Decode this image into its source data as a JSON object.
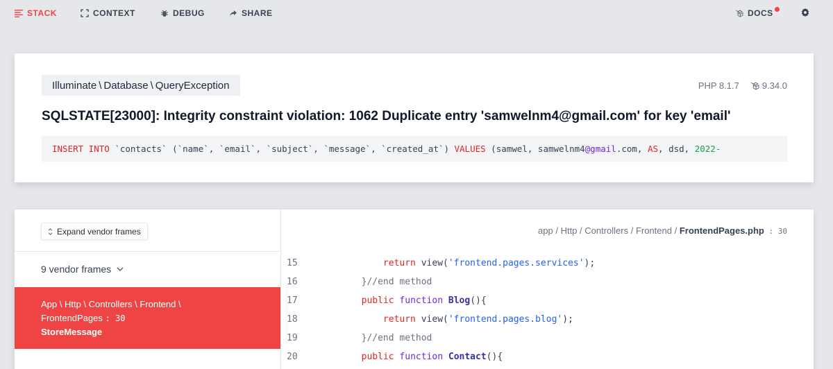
{
  "nav": {
    "stack": "STACK",
    "context": "CONTEXT",
    "debug": "DEBUG",
    "share": "SHARE",
    "docs": "DOCS"
  },
  "exception": {
    "class_parts": [
      "Illuminate",
      "Database",
      "QueryException"
    ],
    "php_version": "PHP 8.1.7",
    "laravel_version": "9.34.0",
    "message": "SQLSTATE[23000]: Integrity constraint violation: 1062 Duplicate entry 'samwelnm4@gmail.com' for key 'email'",
    "sql": {
      "insert_into": "INSERT INTO",
      "columns": " `contacts` (`name`, `email`, `subject`, `message`, `created_at`) ",
      "values_kw": "VALUES",
      "values_a": " (samwel, samwelnm4",
      "at": "@gmail",
      "values_b": ".com, ",
      "as": "AS",
      "values_c": ", dsd, ",
      "date": "2022-"
    }
  },
  "stack": {
    "expand_label": "Expand vendor frames",
    "vendor_frames_label": "9 vendor frames",
    "active_frame": {
      "namespace": "App \\ Http \\ Controllers \\ Frontend \\",
      "class": "FrontendPages",
      "line": ": 30",
      "method": "StoreMessage"
    },
    "file": {
      "dir": "app / Http / Controllers / Frontend / ",
      "name": "FrontendPages.php",
      "line": " : 30"
    },
    "code_lines": [
      {
        "no": "15",
        "indent": "            ",
        "kw": "return",
        "fn": " view(",
        "str": "'frontend.pages.services'",
        "rest": ");"
      },
      {
        "no": "16",
        "indent": "        ",
        "text": "}//end method"
      },
      {
        "no": "17",
        "indent": "        ",
        "kw": "public",
        "kw2": " function ",
        "name": "Blog",
        "rest": "(){"
      },
      {
        "no": "18",
        "indent": "            ",
        "kw": "return",
        "fn": " view(",
        "str": "'frontend.pages.blog'",
        "rest": ");"
      },
      {
        "no": "19",
        "indent": "        ",
        "text": "}//end method"
      },
      {
        "no": "20",
        "indent": "        ",
        "kw": "public",
        "kw2": " function ",
        "name": "Contact",
        "rest": "(){"
      }
    ]
  },
  "colors": {
    "accent": "#ef4444",
    "background": "#e5e7eb"
  }
}
